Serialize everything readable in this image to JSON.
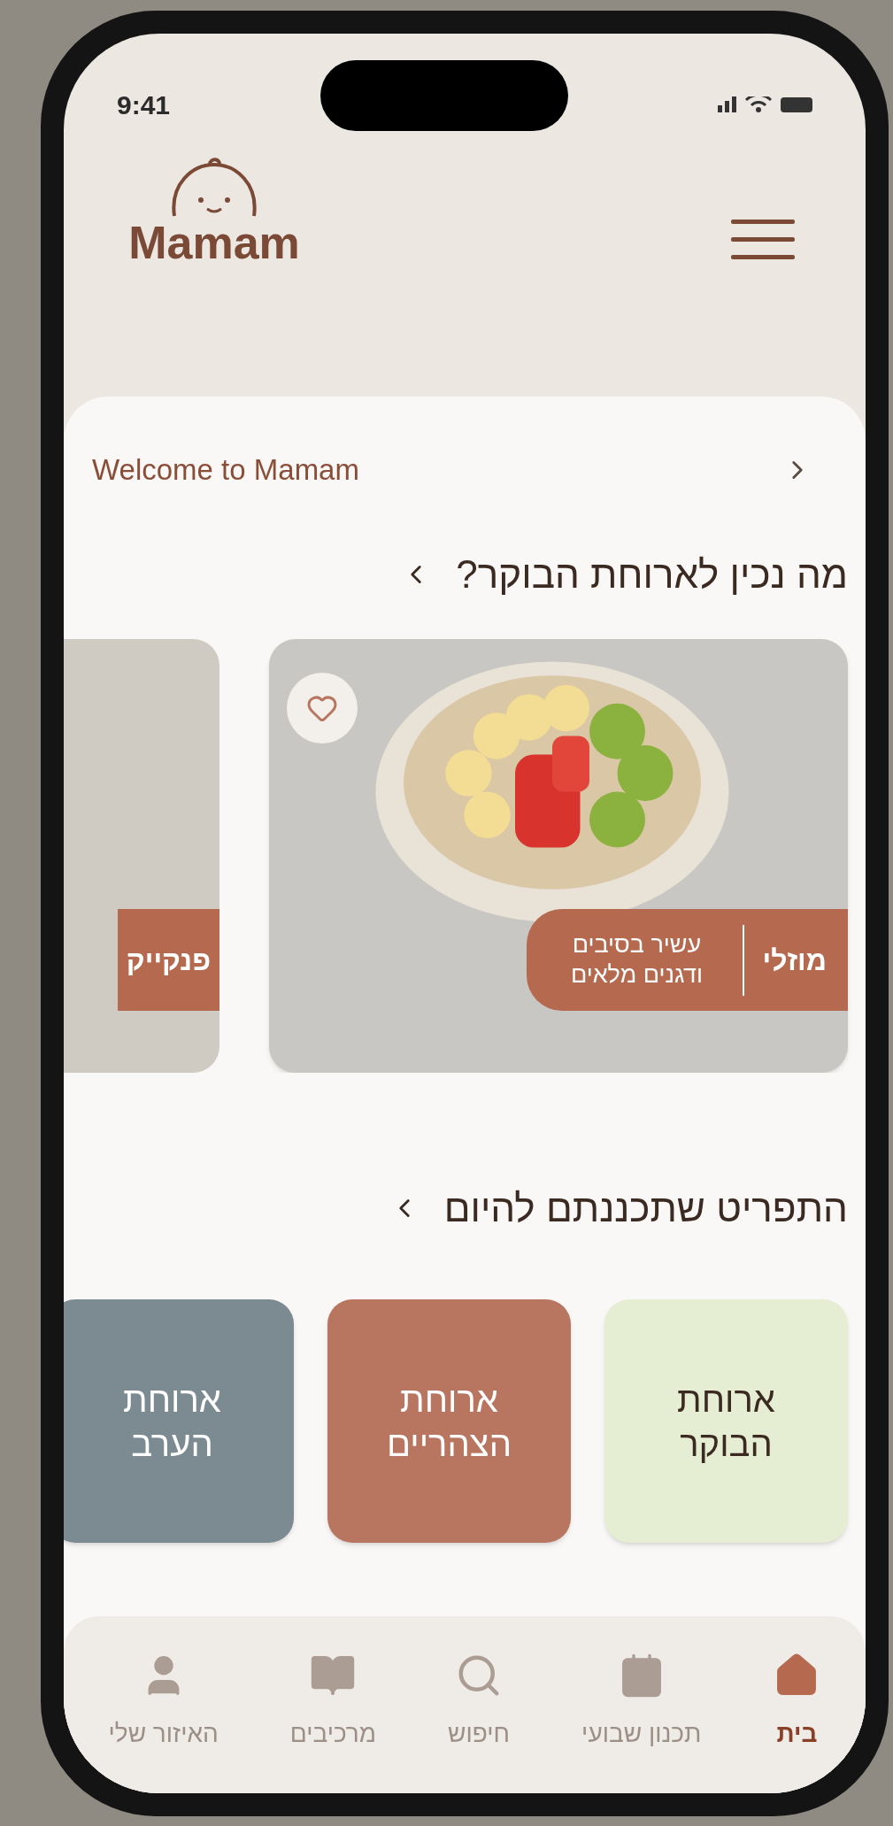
{
  "status_bar": {
    "time": "9:41"
  },
  "header": {
    "logo_text": "Mamam"
  },
  "welcome": {
    "text": "Welcome to Mamam"
  },
  "breakfast_section": {
    "title": "מה נכין לארוחת הבוקר?",
    "cards": [
      {
        "name": "מוזלי",
        "description": "עשיר בסיבים ודגנים מלאים",
        "favorite": false
      },
      {
        "name": "פנקייק"
      }
    ]
  },
  "menu_section": {
    "title": "התפריט שתכננתם להיום",
    "meals": [
      {
        "label": "ארוחת הבוקר",
        "color": "#e5eed2"
      },
      {
        "label": "ארוחת הצהריים",
        "color": "#b87560"
      },
      {
        "label": "ארוחת הערב",
        "color": "#7b8b91"
      }
    ]
  },
  "bottom_nav": [
    {
      "label": "בית",
      "selected": true
    },
    {
      "label": "תכנון שבועי",
      "selected": false
    },
    {
      "label": "חיפוש",
      "selected": false
    },
    {
      "label": "מרכיבים",
      "selected": false
    },
    {
      "label": "האיזור שלי",
      "selected": false
    }
  ]
}
